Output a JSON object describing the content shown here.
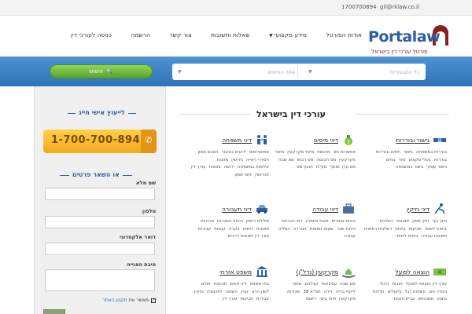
{
  "topbar": {
    "email": "gil@rklaw.co.il",
    "phone": "1700700894"
  },
  "logo": {
    "word": "Portalaw",
    "subtitle": "פורטל עורכי דין בישראל"
  },
  "nav": [
    {
      "label": "אודות הפורטל"
    },
    {
      "label": "מידע מקצועי",
      "dropdown": true
    },
    {
      "label": "שאלות ותשובות"
    },
    {
      "label": "צור קשר"
    },
    {
      "label": "הרשמה"
    },
    {
      "label": "כניסה לעורכי דין"
    }
  ],
  "search": {
    "category_placeholder": "כל הקטגוריות",
    "area_placeholder": "אזור החיפוש",
    "button_label": "חיפוש"
  },
  "sidebar": {
    "consult_title": "לייעוץ אישי חייג",
    "phone_number": "1-700-700-894",
    "form_title": "או השאר פרטים",
    "fields": [
      {
        "label": "שם מלא"
      },
      {
        "label": "טלפון"
      },
      {
        "label": "דואר אלקטרוני"
      },
      {
        "label": "סיבת הפנייה"
      }
    ],
    "consent_text": "מאשר את",
    "consent_link": "תקנון האתר"
  },
  "main": {
    "title": "עורכי דין בישראל",
    "categories": [
      {
        "title": "גישור ובוררות",
        "icon": "handshake-icon",
        "links": [
          "בוררות במשפחה",
          "גישור",
          "חוזים ובוררות",
          "בוררות",
          "בעלי מקצוע",
          "ציוד",
          "בתים",
          "גישור עסקי",
          "גישור במשפחה"
        ]
      },
      {
        "title": "דיני מיסים",
        "icon": "money-bag-icon",
        "links": [
          "אפשרות מס",
          "מרגשת",
          "מיסוי מקרקעין",
          "מיסוי",
          "מקרקעין",
          "מס הכנסה",
          "מס רכוש",
          "מס שבח",
          "מס ערך מוסף",
          "מע\"מ",
          "תכנון מס"
        ]
      },
      {
        "title": "דיני משפחה",
        "icon": "family-icon",
        "links": [
          "אפוטרופוס",
          "ידועים בציבור",
          "הסכם ממון",
          "הסדרי ראייה",
          "גירושין",
          "מזונות",
          "אלימות במשפחה",
          "ירושה",
          "צוואות",
          "עורך דין",
          "לגירושין",
          "יחסי ממון"
        ]
      },
      {
        "title": "דיני נזיקין",
        "icon": "injury-icon",
        "links": [
          "נזקי גוף",
          "נזקי ממון",
          "תאונות",
          "רשלנות",
          "ביטוח לאומי",
          "תביעות",
          "ביטוח",
          "רשלנות רפואית",
          "תאונות עבודה",
          "ביטוח לאומי"
        ]
      },
      {
        "title": "דיני עבודה",
        "icon": "briefcase-icon",
        "links": [
          "זכויות עובדים",
          "פיצויי פיטורין",
          "דמי הבראה",
          "הלנת שכר",
          "שעות נוספות",
          "הטרדה",
          "הפליה",
          "עבודה"
        ]
      },
      {
        "title": "דיני תעבורה",
        "icon": "car-icon",
        "links": [
          "שלילת רישיון",
          "נהיגה בשכרות",
          "מהירות",
          "תאונות",
          "דוחות",
          "בקרה",
          "קנסות",
          "עבירות",
          "עורך דין תאונות דרכים"
        ]
      },
      {
        "title": "הוצאה לפועל",
        "icon": "cash-icon",
        "links": [
          "עורך דין הוצאה לפועל",
          "חובות",
          "ניהול",
          "הסדר חוב",
          "פשיטת רגל",
          "עיקולים",
          "חדלות",
          "ביצוע",
          "משכנתא",
          "גביית חובות"
        ]
      },
      {
        "title": "מקרקעין (נדל\"ן)",
        "icon": "house-hands-icon",
        "links": [
          "מס שבח",
          "עסקאות",
          "קבלנים",
          "מיסוי",
          "ליקויי בנייה",
          "דירה",
          "תמ\"א 38",
          "שכירות",
          "מקרקעין",
          "פינוי בינוי",
          "רישום"
        ]
      },
      {
        "title": "משפט אזרחי",
        "icon": "court-icon",
        "links": [
          "בתי משפט",
          "דיני חוזים",
          "תביעות",
          "חוזים",
          "לשון הרע",
          "קניין",
          "הוצאה",
          "ליטיגציה",
          "נזיקין",
          "עבירות",
          "תביעות",
          "עורך דין"
        ]
      }
    ]
  },
  "colors": {
    "brand_blue": "#2b5fa0",
    "brand_red": "#8b1e22",
    "search_band": "#3b80c4",
    "search_button": "#6cb83a",
    "phone_badge": "#f8b82b"
  }
}
